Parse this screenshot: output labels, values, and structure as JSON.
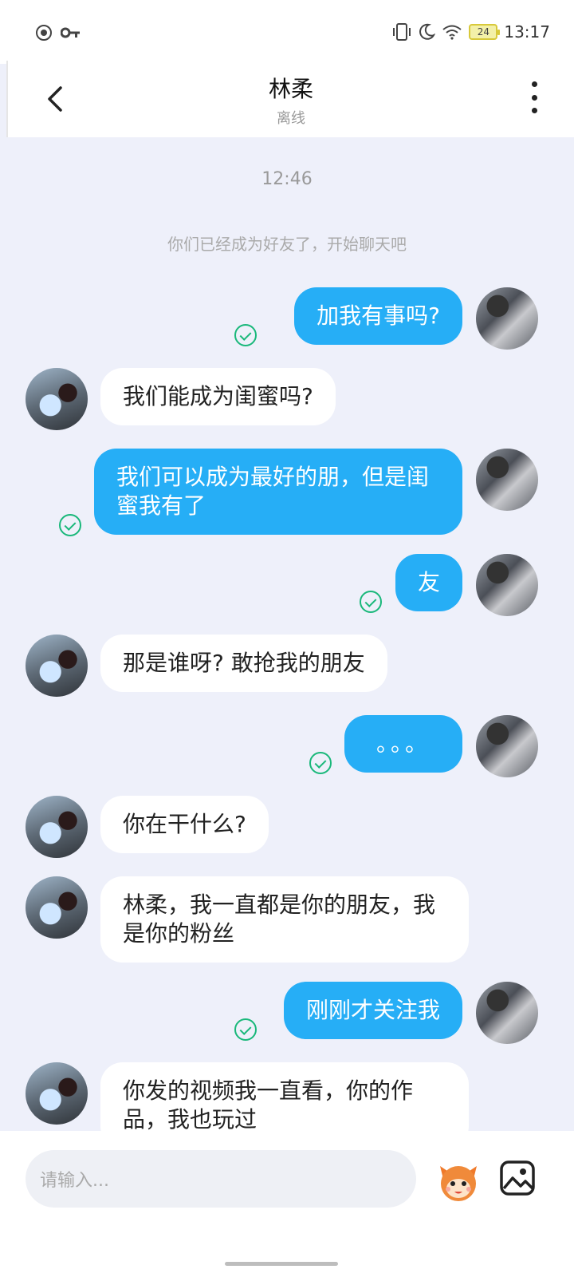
{
  "status_bar": {
    "time": "13:17",
    "battery": "24",
    "icons": [
      "screen-record-icon",
      "key-icon",
      "vibrate-icon",
      "moon-icon",
      "wifi-icon",
      "battery-icon"
    ]
  },
  "header": {
    "title": "林柔",
    "subtitle": "离线",
    "icons": [
      "back-arrow-icon",
      "more-vertical-icon"
    ]
  },
  "chat": {
    "timestamp": "12:46",
    "system_message": "你们已经成为好友了，开始聊天吧",
    "messages": [
      {
        "from": "me",
        "text": "加我有事吗?",
        "status": "read"
      },
      {
        "from": "other",
        "text": "我们能成为闺蜜吗?"
      },
      {
        "from": "me",
        "text": "我们可以成为最好的朋，但是闺蜜我有了",
        "status": "read"
      },
      {
        "from": "me",
        "text": "友",
        "status": "read"
      },
      {
        "from": "other",
        "text": "那是谁呀? 敢抢我的朋友"
      },
      {
        "from": "me",
        "text": "。。。",
        "status": "read"
      },
      {
        "from": "other",
        "text": "你在干什么?"
      },
      {
        "from": "other",
        "text": "林柔，我一直都是你的朋友，我是你的粉丝"
      },
      {
        "from": "me",
        "text": "刚刚才关注我",
        "status": "read"
      },
      {
        "from": "other",
        "text": "你发的视频我一直看，你的作品，我也玩过"
      }
    ]
  },
  "input": {
    "placeholder": "请输入..."
  },
  "colors": {
    "my_bubble": "#26aef6",
    "other_bubble": "#ffffff",
    "chat_background": "#eef0fa",
    "read_check": "#19b87a"
  }
}
